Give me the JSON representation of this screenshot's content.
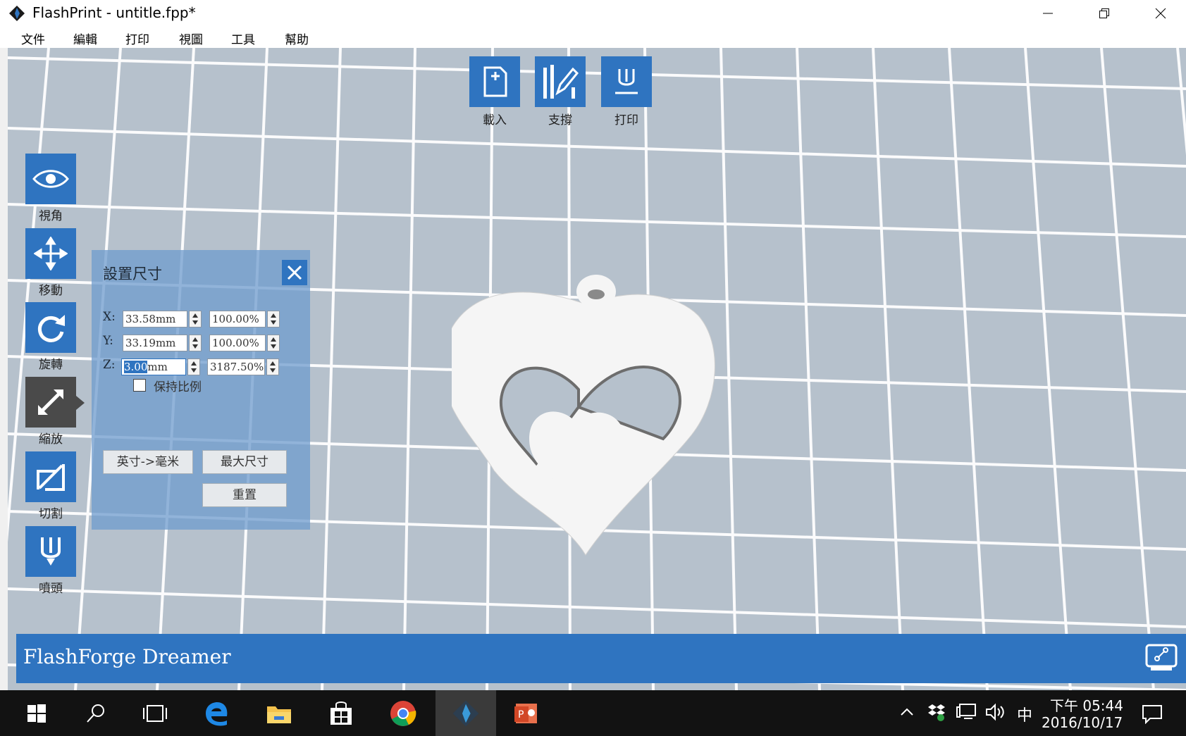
{
  "window": {
    "title": "FlashPrint - untitle.fpp*"
  },
  "menu": [
    "文件",
    "編輯",
    "打印",
    "視圖",
    "工具",
    "幫助"
  ],
  "top_tools": [
    {
      "label": "載入",
      "icon": "load-file-icon"
    },
    {
      "label": "支撐",
      "icon": "support-icon"
    },
    {
      "label": "打印",
      "icon": "print-icon"
    }
  ],
  "left_tools": [
    {
      "label": "視角",
      "icon": "eye-icon"
    },
    {
      "label": "移動",
      "icon": "move-icon"
    },
    {
      "label": "旋轉",
      "icon": "rotate-icon"
    },
    {
      "label": "縮放",
      "icon": "scale-icon",
      "active": true
    },
    {
      "label": "切割",
      "icon": "cut-icon"
    },
    {
      "label": "噴頭",
      "icon": "nozzle-icon"
    }
  ],
  "scale_panel": {
    "title": "設置尺寸",
    "x": {
      "label": "X:",
      "size": "33.58mm",
      "percent": "100.00%"
    },
    "y": {
      "label": "Y:",
      "size": "33.19mm",
      "percent": "100.00%"
    },
    "z": {
      "label": "Z:",
      "size_selected": "3.00",
      "size_unit": "mm",
      "percent": "3187.50%"
    },
    "keep_ratio_label": "保持比例",
    "keep_ratio_checked": false,
    "inch_to_mm_label": "英寸->毫米",
    "max_size_label": "最大尺寸",
    "reset_label": "重置"
  },
  "status": {
    "printer_name": "FlashForge Dreamer"
  },
  "taskbar": {
    "clock_time": "下午 05:44",
    "clock_date": "2016/10/17",
    "ime": "中"
  },
  "colors": {
    "accent": "#2f74c0",
    "viewport": "#b6c1cc",
    "active_tool": "#4a4a4a"
  }
}
